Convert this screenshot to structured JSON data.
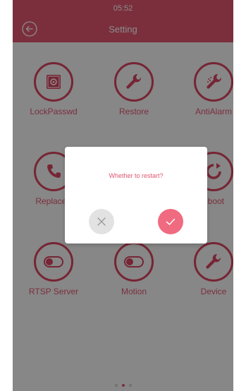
{
  "status": {
    "time": "05:52"
  },
  "header": {
    "title": "Setting",
    "back_icon": "back-arrow-icon"
  },
  "grid": [
    {
      "label": "LockPasswd",
      "icon": "safe-lock-icon"
    },
    {
      "label": "Restore",
      "icon": "wrench-icon"
    },
    {
      "label": "AntiAlarm",
      "icon": "anti-alarm-wrench-icon"
    },
    {
      "label": "ReplaceF",
      "icon": "phone-icon"
    },
    {
      "label": "eboot",
      "icon": "reboot-icon"
    },
    {
      "label": "RTSP Server",
      "icon": "toggle-icon"
    },
    {
      "label": "Motion",
      "icon": "toggle-icon"
    },
    {
      "label": "Device",
      "icon": "wrench-icon"
    }
  ],
  "dialog": {
    "message": "Whether to restart?",
    "cancel_icon": "close-icon",
    "confirm_icon": "check-icon"
  },
  "pagination": {
    "dots": 3,
    "active": 1
  },
  "colors": {
    "accent": "#e0566f",
    "overlay": "#000000"
  }
}
